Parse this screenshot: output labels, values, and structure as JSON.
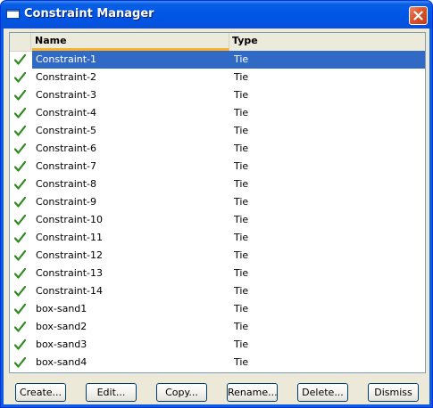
{
  "window": {
    "title": "Constraint Manager"
  },
  "table": {
    "columns": [
      {
        "label": ""
      },
      {
        "label": "Name",
        "sorted": true
      },
      {
        "label": "Type"
      }
    ],
    "selected_index": 0,
    "rows": [
      {
        "checked": true,
        "name": "Constraint-1",
        "type": "Tie"
      },
      {
        "checked": true,
        "name": "Constraint-2",
        "type": "Tie"
      },
      {
        "checked": true,
        "name": "Constraint-3",
        "type": "Tie"
      },
      {
        "checked": true,
        "name": "Constraint-4",
        "type": "Tie"
      },
      {
        "checked": true,
        "name": "Constraint-5",
        "type": "Tie"
      },
      {
        "checked": true,
        "name": "Constraint-6",
        "type": "Tie"
      },
      {
        "checked": true,
        "name": "Constraint-7",
        "type": "Tie"
      },
      {
        "checked": true,
        "name": "Constraint-8",
        "type": "Tie"
      },
      {
        "checked": true,
        "name": "Constraint-9",
        "type": "Tie"
      },
      {
        "checked": true,
        "name": "Constraint-10",
        "type": "Tie"
      },
      {
        "checked": true,
        "name": "Constraint-11",
        "type": "Tie"
      },
      {
        "checked": true,
        "name": "Constraint-12",
        "type": "Tie"
      },
      {
        "checked": true,
        "name": "Constraint-13",
        "type": "Tie"
      },
      {
        "checked": true,
        "name": "Constraint-14",
        "type": "Tie"
      },
      {
        "checked": true,
        "name": "box-sand1",
        "type": "Tie"
      },
      {
        "checked": true,
        "name": "box-sand2",
        "type": "Tie"
      },
      {
        "checked": true,
        "name": "box-sand3",
        "type": "Tie"
      },
      {
        "checked": true,
        "name": "box-sand4",
        "type": "Tie"
      }
    ]
  },
  "buttons": {
    "create": "Create...",
    "edit": "Edit...",
    "copy": "Copy...",
    "rename": "Rename...",
    "delete": "Delete...",
    "dismiss": "Dismiss"
  },
  "colors": {
    "selection": "#316ac5",
    "check": "#2e8b1e",
    "titlebar": "#0054e3",
    "close_button": "#d9552b",
    "sort_indicator": "#f9b12a"
  },
  "icons": {
    "row_status": "check-icon",
    "close": "close-icon",
    "window": "window-icon"
  }
}
